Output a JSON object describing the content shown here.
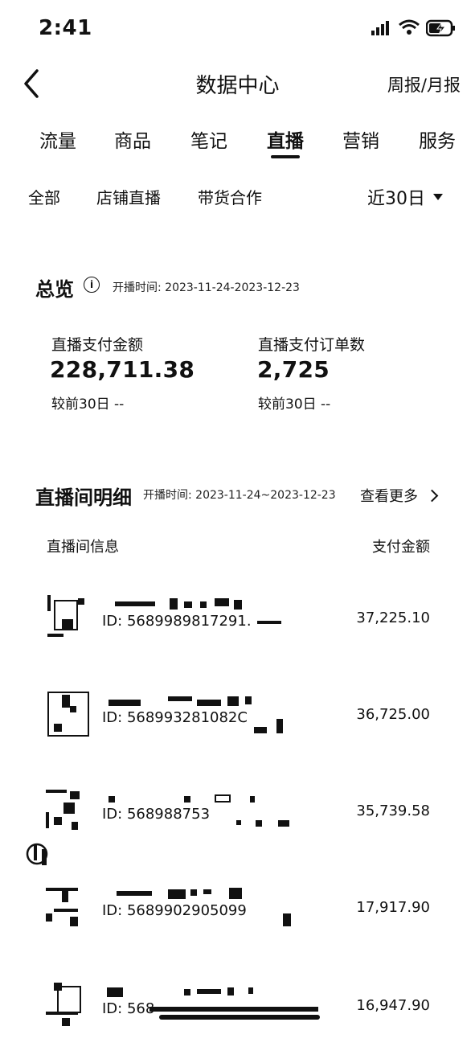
{
  "status_bar": {
    "time": "2:41"
  },
  "nav": {
    "title": "数据中心",
    "report_link": "周报/月报"
  },
  "main_tabs": [
    {
      "label": "流量"
    },
    {
      "label": "商品"
    },
    {
      "label": "笔记"
    },
    {
      "label": "直播"
    },
    {
      "label": "营销"
    },
    {
      "label": "服务"
    }
  ],
  "active_tab": "直播",
  "sub_tabs": [
    {
      "label": "全部"
    },
    {
      "label": "店铺直播"
    },
    {
      "label": "带货合作"
    }
  ],
  "range_select": {
    "value": "近30日"
  },
  "overview": {
    "title": "总览",
    "info_glyph": "i",
    "range": "开播时间: 2023-11-24-2023-12-23",
    "metrics": [
      {
        "label": "直播支付金额",
        "value": "228,711.38",
        "compare": "较前30日 --"
      },
      {
        "label": "直播支付订单数",
        "value": "2,725",
        "compare": "较前30日 --"
      }
    ]
  },
  "detail": {
    "title": "直播间明细",
    "range": "开播时间: 2023-11-24~2023-12-23",
    "view_more": "查看更多",
    "columns": {
      "info": "直播间信息",
      "amount": "支付金额"
    },
    "rows": [
      {
        "id": "ID:  5689989817291.",
        "amount": "37,225.10"
      },
      {
        "id": "ID:  568993281082C",
        "amount": "36,725.00"
      },
      {
        "id": "ID:  56898875​3",
        "amount": "35,739.58"
      },
      {
        "id": "ID:  5689902905099",
        "amount": "17,917.90"
      },
      {
        "id": "ID:  568",
        "amount": "16,947.90"
      }
    ]
  },
  "colors": {
    "text": "#111111",
    "background": "#ffffff"
  }
}
